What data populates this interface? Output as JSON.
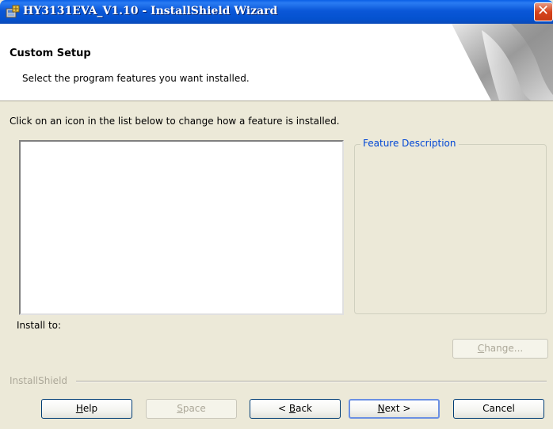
{
  "window": {
    "title": "HY3131EVA_V1.10 - InstallShield Wizard",
    "close_glyph": "✕"
  },
  "banner": {
    "title": "Custom Setup",
    "subtitle": "Select the program features you want installed."
  },
  "instruction": "Click on an icon in the list below to change how a feature is installed.",
  "feature_description": {
    "legend": "Feature Description"
  },
  "install_to": {
    "label": "Install to:"
  },
  "buttons": {
    "change": {
      "pre": "",
      "u": "C",
      "post": "hange..."
    },
    "help": {
      "pre": "",
      "u": "H",
      "post": "elp"
    },
    "space": {
      "pre": "",
      "u": "S",
      "post": "pace"
    },
    "back": {
      "pre": "< ",
      "u": "B",
      "post": "ack"
    },
    "next": {
      "pre": "",
      "u": "N",
      "post": "ext >"
    },
    "cancel": "Cancel"
  },
  "footer": {
    "brand": "InstallShield"
  },
  "colors": {
    "titlebar": "#0a57d8",
    "dialog_bg": "#ece9d8",
    "legend_text": "#0046d5",
    "disabled_text": "#aca899"
  },
  "icons": [
    "installer-icon",
    "close-icon",
    "banner-graphic"
  ]
}
